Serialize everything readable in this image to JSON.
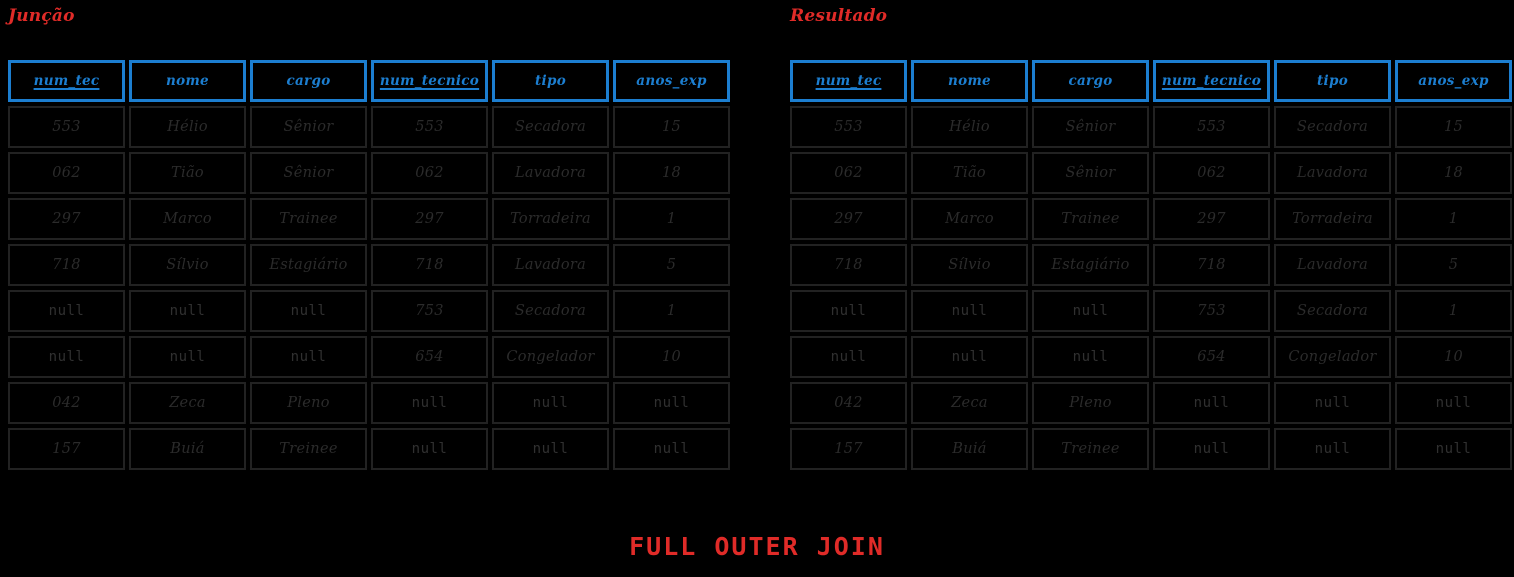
{
  "theme": {
    "background": "#000000",
    "accent_red": "#e02b28",
    "accent_blue": "#1c7ed0",
    "cell_border": "#222222",
    "cell_text": "#2b2b2b"
  },
  "caption": "FULL OUTER JOIN",
  "columns": [
    {
      "label": "num_tec",
      "key": true
    },
    {
      "label": "nome",
      "key": false
    },
    {
      "label": "cargo",
      "key": false
    },
    {
      "label": "num_tecnico",
      "key": true
    },
    {
      "label": "tipo",
      "key": false
    },
    {
      "label": "anos_exp",
      "key": false
    }
  ],
  "tables": [
    {
      "title": "Junção",
      "rows": [
        [
          "553",
          "Hélio",
          "Sênior",
          "553",
          "Secadora",
          "15"
        ],
        [
          "062",
          "Tião",
          "Sênior",
          "062",
          "Lavadora",
          "18"
        ],
        [
          "297",
          "Marco",
          "Trainee",
          "297",
          "Torradeira",
          "1"
        ],
        [
          "718",
          "Sílvio",
          "Estagiário",
          "718",
          "Lavadora",
          "5"
        ],
        [
          "null",
          "null",
          "null",
          "753",
          "Secadora",
          "1"
        ],
        [
          "null",
          "null",
          "null",
          "654",
          "Congelador",
          "10"
        ],
        [
          "042",
          "Zeca",
          "Pleno",
          "null",
          "null",
          "null"
        ],
        [
          "157",
          "Buiá",
          "Treinee",
          "null",
          "null",
          "null"
        ]
      ]
    },
    {
      "title": "Resultado",
      "rows": [
        [
          "553",
          "Hélio",
          "Sênior",
          "553",
          "Secadora",
          "15"
        ],
        [
          "062",
          "Tião",
          "Sênior",
          "062",
          "Lavadora",
          "18"
        ],
        [
          "297",
          "Marco",
          "Trainee",
          "297",
          "Torradeira",
          "1"
        ],
        [
          "718",
          "Sílvio",
          "Estagiário",
          "718",
          "Lavadora",
          "5"
        ],
        [
          "null",
          "null",
          "null",
          "753",
          "Secadora",
          "1"
        ],
        [
          "null",
          "null",
          "null",
          "654",
          "Congelador",
          "10"
        ],
        [
          "042",
          "Zeca",
          "Pleno",
          "null",
          "null",
          "null"
        ],
        [
          "157",
          "Buiá",
          "Treinee",
          "null",
          "null",
          "null"
        ]
      ]
    }
  ]
}
